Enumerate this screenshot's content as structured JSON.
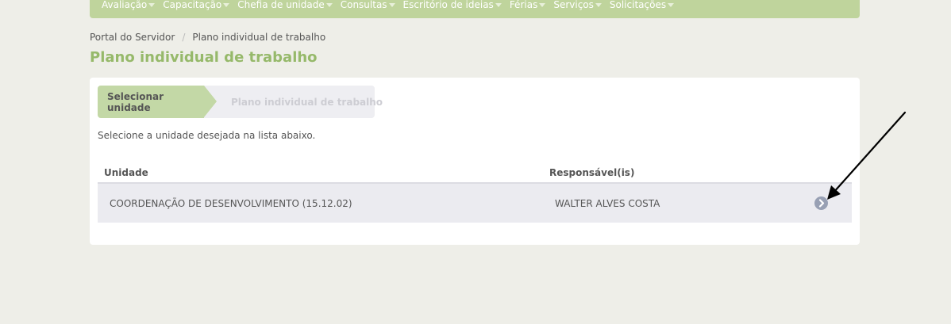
{
  "topnav": {
    "items": [
      {
        "label": "Avaliação"
      },
      {
        "label": "Capacitação"
      },
      {
        "label": "Chefia de unidade"
      },
      {
        "label": "Consultas"
      },
      {
        "label": "Escritório de ideias"
      },
      {
        "label": "Férias"
      },
      {
        "label": "Serviços"
      },
      {
        "label": "Solicitações"
      }
    ]
  },
  "breadcrumb": {
    "home": "Portal do Servidor",
    "separator": "/",
    "current": "Plano individual de trabalho"
  },
  "page": {
    "title": "Plano individual de trabalho"
  },
  "wizard": {
    "step1": "Selecionar unidade",
    "step2": "Plano individual de trabalho"
  },
  "instruction": "Selecione a unidade desejada na lista abaixo.",
  "table": {
    "headers": {
      "unidade": "Unidade",
      "responsavel": "Responsável(is)"
    },
    "rows": [
      {
        "unidade": "COORDENAÇÃO DE DESENVOLVIMENTO (15.12.02)",
        "responsavel": "WALTER ALVES COSTA",
        "action_icon": "chevron-right-circle-icon"
      }
    ]
  },
  "colors": {
    "nav_bg": "#bfd49c",
    "title": "#96b96a",
    "step_active": "#c3d8a6",
    "page_bg": "#eeeee8"
  },
  "annotation": {
    "icon": "arrow-pointer-icon"
  }
}
